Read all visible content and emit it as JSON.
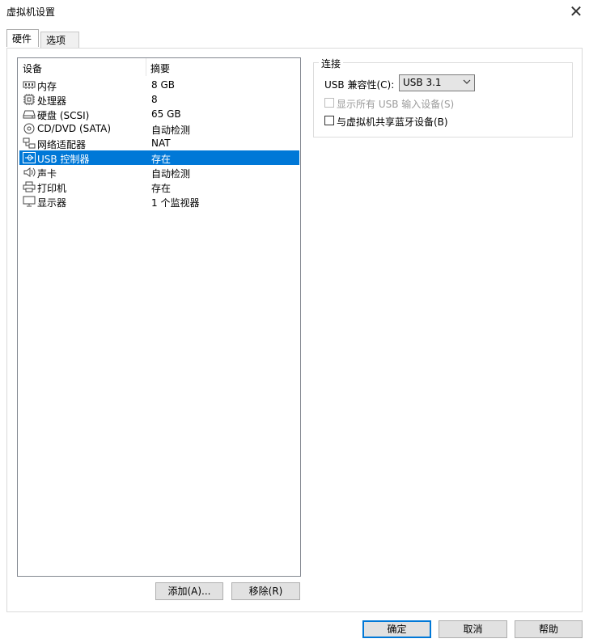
{
  "window": {
    "title": "虚拟机设置"
  },
  "tabs": [
    {
      "label": "硬件",
      "active": true
    },
    {
      "label": "选项",
      "active": false
    }
  ],
  "device_list": {
    "columns": [
      "设备",
      "摘要"
    ],
    "rows": [
      {
        "name": "内存",
        "summary": "8 GB",
        "icon": "memory-icon"
      },
      {
        "name": "处理器",
        "summary": "8",
        "icon": "processor-icon"
      },
      {
        "name": "硬盘 (SCSI)",
        "summary": "65 GB",
        "icon": "hard-disk-icon"
      },
      {
        "name": "CD/DVD (SATA)",
        "summary": "自动检测",
        "icon": "cd-dvd-icon"
      },
      {
        "name": "网络适配器",
        "summary": "NAT",
        "icon": "network-adapter-icon"
      },
      {
        "name": "USB 控制器",
        "summary": "存在",
        "icon": "usb-icon",
        "selected": true
      },
      {
        "name": "声卡",
        "summary": "自动检测",
        "icon": "speaker-icon"
      },
      {
        "name": "打印机",
        "summary": "存在",
        "icon": "printer-icon"
      },
      {
        "name": "显示器",
        "summary": "1 个监视器",
        "icon": "monitor-icon"
      }
    ],
    "selected_color": "#0078d7"
  },
  "list_buttons": {
    "add": "添加(A)...",
    "remove": "移除(R)"
  },
  "connection": {
    "group_title": "连接",
    "usb_compat_label": "USB 兼容性(C):",
    "usb_compat_value": "USB 3.1",
    "show_all_usb": {
      "label": "显示所有 USB 输入设备(S)",
      "checked": false,
      "disabled": true
    },
    "share_bluetooth": {
      "label": "与虚拟机共享蓝牙设备(B)",
      "checked": false,
      "disabled": false
    }
  },
  "dialog_buttons": {
    "ok": "确定",
    "cancel": "取消",
    "help": "帮助"
  }
}
